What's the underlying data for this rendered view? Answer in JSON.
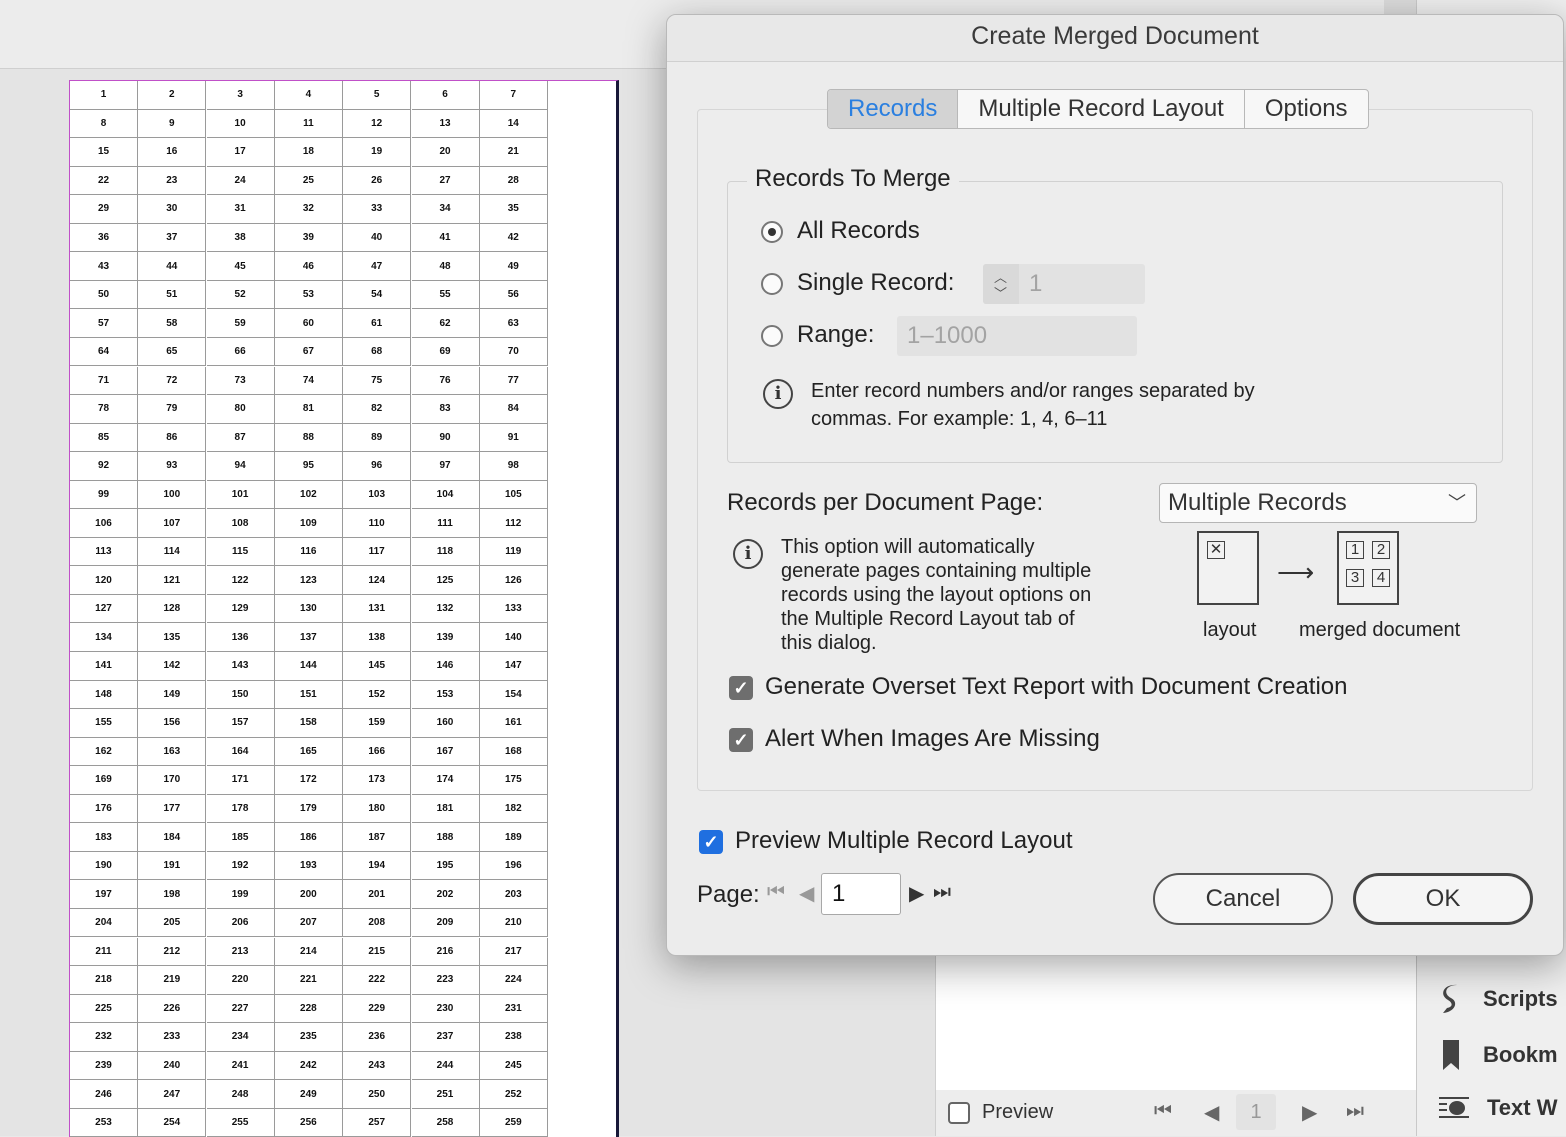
{
  "grid": {
    "rows": 37,
    "cols": 7,
    "start": 1
  },
  "right_panel": {
    "preview_label": "Preview",
    "page_value": "1",
    "nav": {
      "first": "⏮",
      "prev": "◀",
      "next": "▶",
      "last": "⏭"
    }
  },
  "side_panel": {
    "items": [
      {
        "label": "Scripts",
        "icon": "scripts-icon"
      },
      {
        "label": "Bookm",
        "icon": "bookmark-icon"
      },
      {
        "label": "Text W",
        "icon": "text-wrap-icon"
      }
    ]
  },
  "dialog": {
    "title": "Create Merged Document",
    "tabs": [
      {
        "label": "Records",
        "active": true
      },
      {
        "label": "Multiple Record Layout",
        "active": false
      },
      {
        "label": "Options",
        "active": false
      }
    ],
    "records_group": {
      "title": "Records To Merge",
      "all_records": "All Records",
      "single_record": "Single Record:",
      "single_record_value": "1",
      "range": "Range:",
      "range_placeholder": "1–1000",
      "info_text_line1": "Enter record numbers and/or ranges separated by",
      "info_text_line2": "commas. For example: 1, 4, 6–11",
      "selected": "all"
    },
    "records_per_page": {
      "label": "Records per Document Page:",
      "value": "Multiple Records",
      "info_line1": "This option will automatically",
      "info_line2": "generate pages containing multiple",
      "info_line3": "records using the layout options on",
      "info_line4": "the Multiple Record Layout tab of",
      "info_line5": "this dialog.",
      "layout_caption": "layout",
      "merged_caption": "merged document",
      "merged_cells": [
        "1",
        "2",
        "3",
        "4"
      ]
    },
    "checkboxes": {
      "overset": "Generate Overset Text Report with Document Creation",
      "missing_images": "Alert When Images Are Missing",
      "preview": "Preview Multiple Record Layout"
    },
    "page": {
      "label": "Page:",
      "value": "1"
    },
    "buttons": {
      "cancel": "Cancel",
      "ok": "OK"
    },
    "accent_color": "#2a7fe0"
  }
}
